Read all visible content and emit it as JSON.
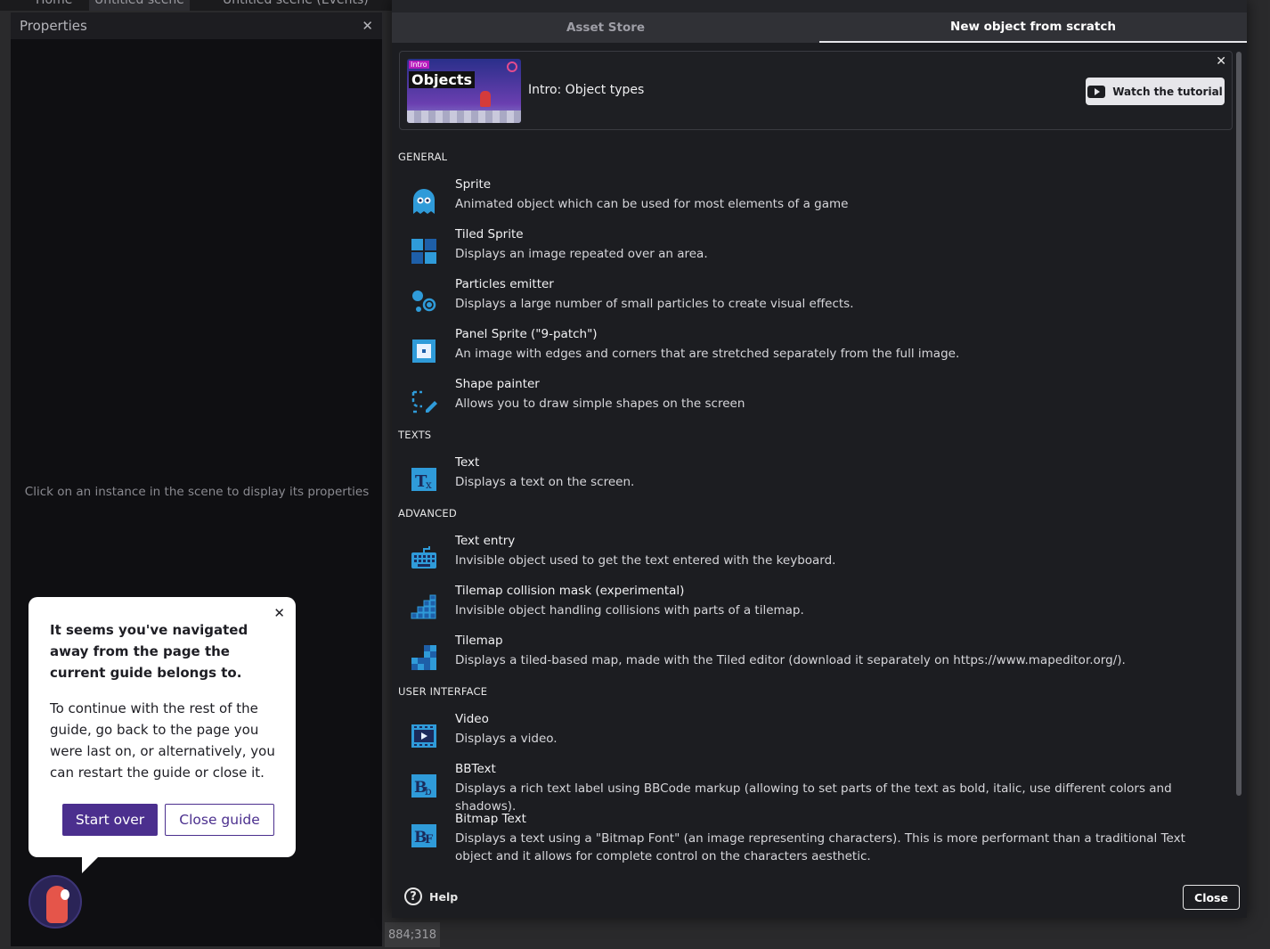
{
  "top_tabs": [
    "Home",
    "Untitled scene",
    "Untitled scene (Events)"
  ],
  "properties": {
    "title": "Properties",
    "empty_message": "Click on an instance in the scene to display its properties"
  },
  "coords": "884;318",
  "dialog": {
    "tabs": [
      {
        "label": "Asset Store",
        "active": false
      },
      {
        "label": "New object from scratch",
        "active": true
      }
    ],
    "intro": {
      "thumbnail_tag": "Intro",
      "thumbnail_word": "Objects",
      "label": "Intro: Object types",
      "watch_button": "Watch the tutorial"
    },
    "sections": {
      "general": "GENERAL",
      "texts": "TEXTS",
      "advanced": "ADVANCED",
      "user_interface": "USER INTERFACE"
    },
    "items": [
      {
        "name": "Sprite",
        "desc": "Animated object which can be used for most elements of a game",
        "icon": "ghost-icon"
      },
      {
        "name": "Tiled Sprite",
        "desc": "Displays an image repeated over an area.",
        "icon": "tiles-icon"
      },
      {
        "name": "Particles emitter",
        "desc": "Displays a large number of small particles to create visual effects.",
        "icon": "particles-icon"
      },
      {
        "name": "Panel Sprite (\"9-patch\")",
        "desc": "An image with edges and corners that are stretched separately from the full image.",
        "icon": "nine-patch-icon"
      },
      {
        "name": "Shape painter",
        "desc": "Allows you to draw simple shapes on the screen",
        "icon": "shape-painter-icon"
      },
      {
        "name": "Text",
        "desc": "Displays a text on the screen.",
        "icon": "text-icon"
      },
      {
        "name": "Text entry",
        "desc": "Invisible object used to get the text entered with the keyboard.",
        "icon": "keyboard-icon"
      },
      {
        "name": "Tilemap collision mask (experimental)",
        "desc": "Invisible object handling collisions with parts of a tilemap.",
        "icon": "tilemap-mask-icon"
      },
      {
        "name": "Tilemap",
        "desc": "Displays a tiled-based map, made with the Tiled editor (download it separately on https://www.mapeditor.org/).",
        "icon": "tilemap-icon"
      },
      {
        "name": "Video",
        "desc": "Displays a video.",
        "icon": "video-icon"
      },
      {
        "name": "BBText",
        "desc": "Displays a rich text label using BBCode markup (allowing to set parts of the text as bold, italic, use different colors and shadows).",
        "icon": "bbtext-icon"
      },
      {
        "name": "Bitmap Text",
        "desc": "Displays a text using a \"Bitmap Font\" (an image representing characters). This is more performant than a traditional Text object and it allows for complete control on the characters aesthetic.",
        "icon": "bitmap-text-icon"
      }
    ],
    "help_label": "Help",
    "close_label": "Close"
  },
  "guide": {
    "title": "It seems you've navigated away from the page the current guide belongs to.",
    "body": "To continue with the rest of the guide, go back to the page you were last on, or alternatively, you can restart the guide or close it.",
    "start_over": "Start over",
    "close_guide": "Close guide"
  },
  "colors": {
    "accent_purple": "#4b2f8e",
    "icon_blue": "#2f9bd9",
    "dialog_bg": "#1c1d21"
  }
}
